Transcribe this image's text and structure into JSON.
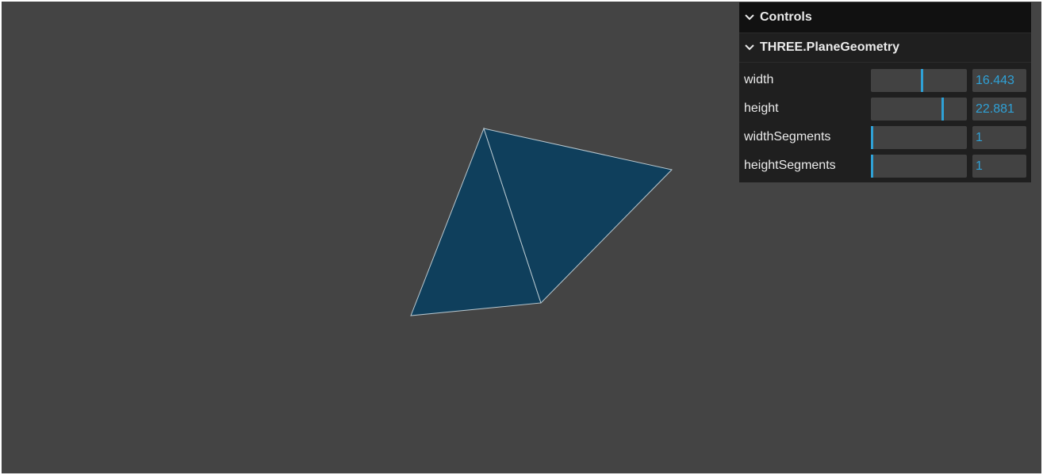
{
  "gui": {
    "title": "Controls",
    "folder": {
      "title": "THREE.PlaneGeometry",
      "params": [
        {
          "label": "width",
          "value": "16.443",
          "fill": 0.53
        },
        {
          "label": "height",
          "value": "22.881",
          "fill": 0.75
        },
        {
          "label": "widthSegments",
          "value": "1",
          "fill": 0.0
        },
        {
          "label": "heightSegments",
          "value": "1",
          "fill": 0.0
        }
      ]
    }
  },
  "colors": {
    "background": "#444444",
    "mesh_fill": "#0f3f5c",
    "wireframe": "#b8c8d0",
    "accent": "#2fa1d6"
  }
}
